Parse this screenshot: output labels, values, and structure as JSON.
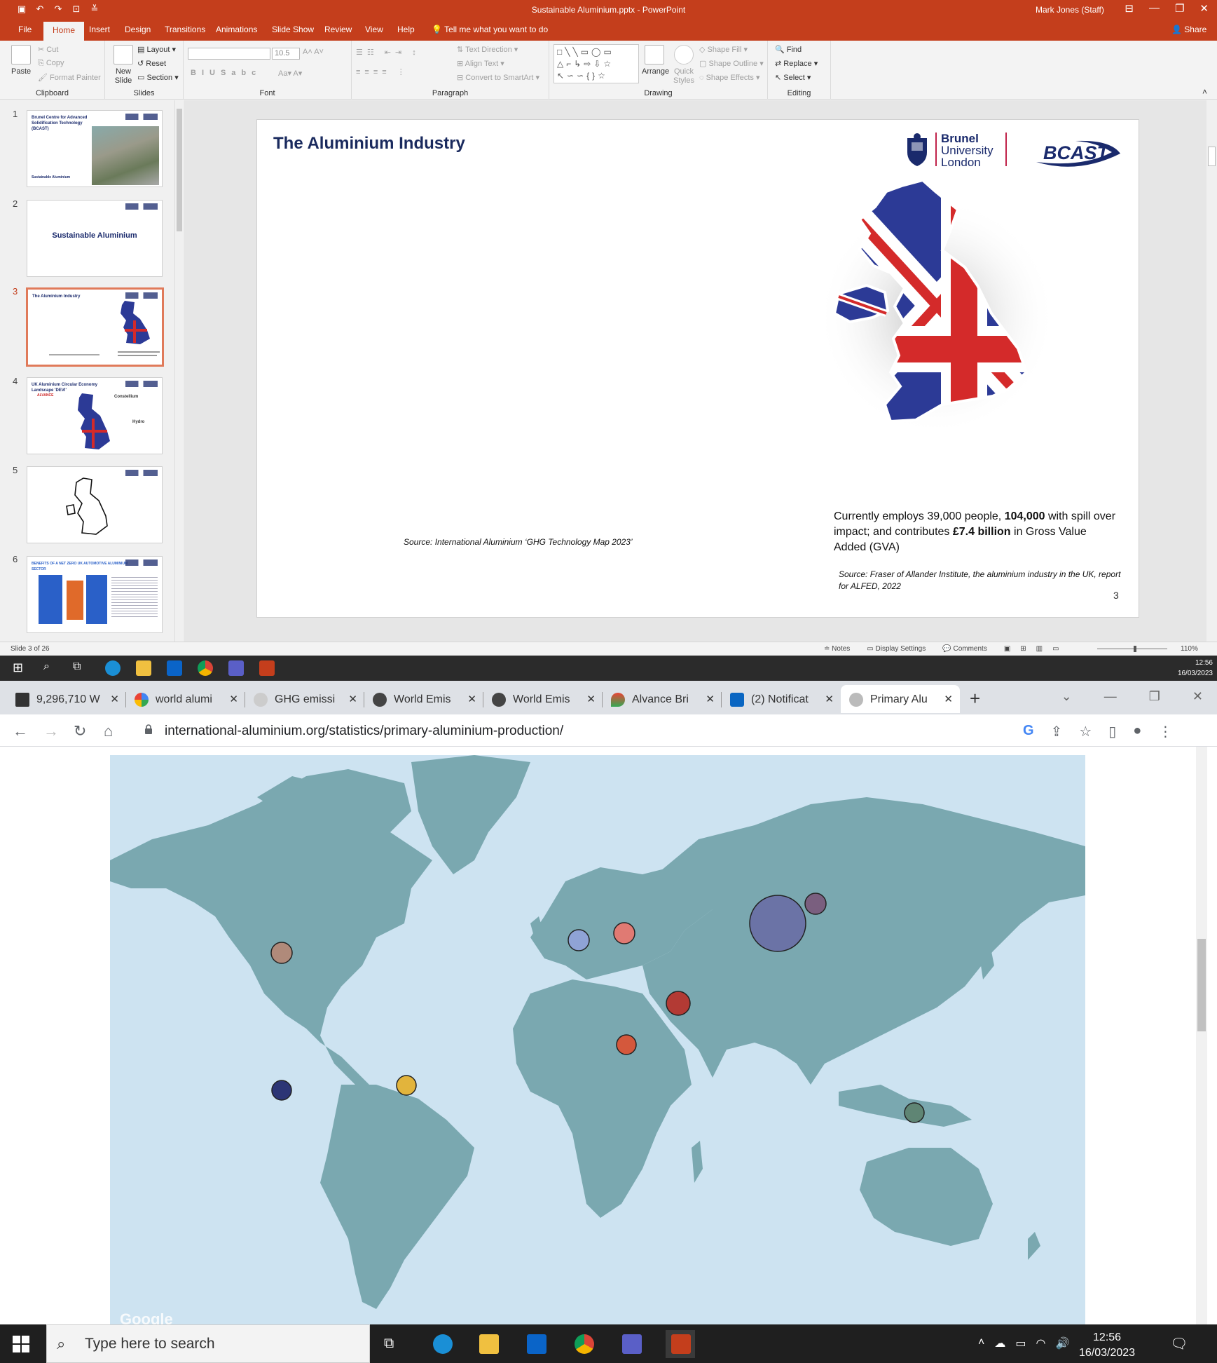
{
  "ppt": {
    "window_title": "Sustainable Aluminium.pptx  -  PowerPoint",
    "user": "Mark Jones (Staff)",
    "tabs": [
      "File",
      "Home",
      "Insert",
      "Design",
      "Transitions",
      "Animations",
      "Slide Show",
      "Review",
      "View",
      "Help"
    ],
    "tell_me": "Tell me what you want to do",
    "share": "Share",
    "ribbon": {
      "clipboard": {
        "paste": "Paste",
        "cut": "Cut",
        "copy": "Copy",
        "format_painter": "Format Painter",
        "label": "Clipboard"
      },
      "slides": {
        "new_slide": "New Slide",
        "layout": "Layout",
        "reset": "Reset",
        "section": "Section",
        "label": "Slides"
      },
      "font": {
        "size": "10.5",
        "label": "Font"
      },
      "paragraph": {
        "text_direction": "Text Direction",
        "align_text": "Align Text",
        "convert": "Convert to SmartArt",
        "label": "Paragraph"
      },
      "drawing": {
        "arrange": "Arrange",
        "quick_styles": "Quick Styles",
        "shape_fill": "Shape Fill",
        "shape_outline": "Shape Outline",
        "shape_effects": "Shape Effects",
        "label": "Drawing"
      },
      "editing": {
        "find": "Find",
        "replace": "Replace",
        "select": "Select",
        "label": "Editing"
      }
    },
    "thumbnails": [
      {
        "num": "1",
        "title": "Brunel Centre for Advanced Solidification Technology (BCAST)",
        "subtitle": "Sustainable Aluminium"
      },
      {
        "num": "2",
        "title": "Sustainable Aluminium"
      },
      {
        "num": "3",
        "title": "The Aluminium Industry"
      },
      {
        "num": "4",
        "title": "UK Aluminium Circular Economy Landscape 'DEVI'",
        "labels": [
          "ALVANCE",
          "Constellium",
          "Hydro"
        ]
      },
      {
        "num": "5",
        "title": ""
      },
      {
        "num": "6",
        "title": "BENEFITS OF A NET ZERO UK AUTOMOTIVE ALUMINIUM SECTOR"
      }
    ],
    "slide": {
      "title": "The Aluminium Industry",
      "source1": "Source: International Aluminium ‘GHG Technology Map 2023’",
      "body_pre": "Currently employs 39,000 people, ",
      "body_bold1": "104,000",
      "body_mid": " with spill over impact; and contributes ",
      "body_bold2": "£7.4 billion",
      "body_post": " in Gross Value Added (GVA)",
      "source2": "Source: Fraser of Allander Institute, the aluminium industry in the UK, report for ALFED, 2022",
      "page_number": "3",
      "logo_brunel_lines": [
        "Brunel",
        "University",
        "London"
      ],
      "logo_bcast": "BCAST"
    },
    "status": {
      "slide_of": "Slide 3 of 26",
      "notes": "Notes",
      "display_settings": "Display Settings",
      "comments": "Comments",
      "zoom": "110%"
    }
  },
  "taskbar_inner": {
    "time": "12:56",
    "date": "16/03/2023"
  },
  "chrome": {
    "tabs": [
      {
        "label": "9,296,710 W",
        "favicon": "g-square"
      },
      {
        "label": "world alumi",
        "favicon": "google"
      },
      {
        "label": "GHG emissi",
        "favicon": "ia-globe"
      },
      {
        "label": "World Emis",
        "favicon": "globe"
      },
      {
        "label": "World Emis",
        "favicon": "globe"
      },
      {
        "label": "Alvance Bri",
        "favicon": "maps-pin"
      },
      {
        "label": "(2) Notificat",
        "favicon": "linkedin"
      },
      {
        "label": "Primary Alu",
        "favicon": "ia-globe",
        "active": true
      }
    ],
    "url": "international-aluminium.org/statistics/primary-aluminium-production/"
  },
  "map": {
    "attribution": "Google",
    "colors": {
      "ocean": "#cde3f1",
      "land": "#7aa8b0"
    },
    "bubbles": [
      {
        "region": "North America",
        "color": "#b08a7a"
      },
      {
        "region": "Oceania (unlabelled point)",
        "color": "#2c3575"
      },
      {
        "region": "South America",
        "color": "#e2b43c"
      },
      {
        "region": "Western Europe",
        "color": "#8fa3d6"
      },
      {
        "region": "East & Central Europe",
        "color": "#e07a73"
      },
      {
        "region": "GCC",
        "color": "#b33a34"
      },
      {
        "region": "Africa",
        "color": "#d4583c"
      },
      {
        "region": "Russia",
        "color": "#7a5f7f"
      },
      {
        "region": "China / Asia",
        "color": "#6b73a6"
      },
      {
        "region": "Oceania",
        "color": "#5f8574"
      }
    ]
  },
  "taskbar_outer": {
    "search_placeholder": "Type here to search",
    "time": "12:56",
    "date": "16/03/2023"
  }
}
